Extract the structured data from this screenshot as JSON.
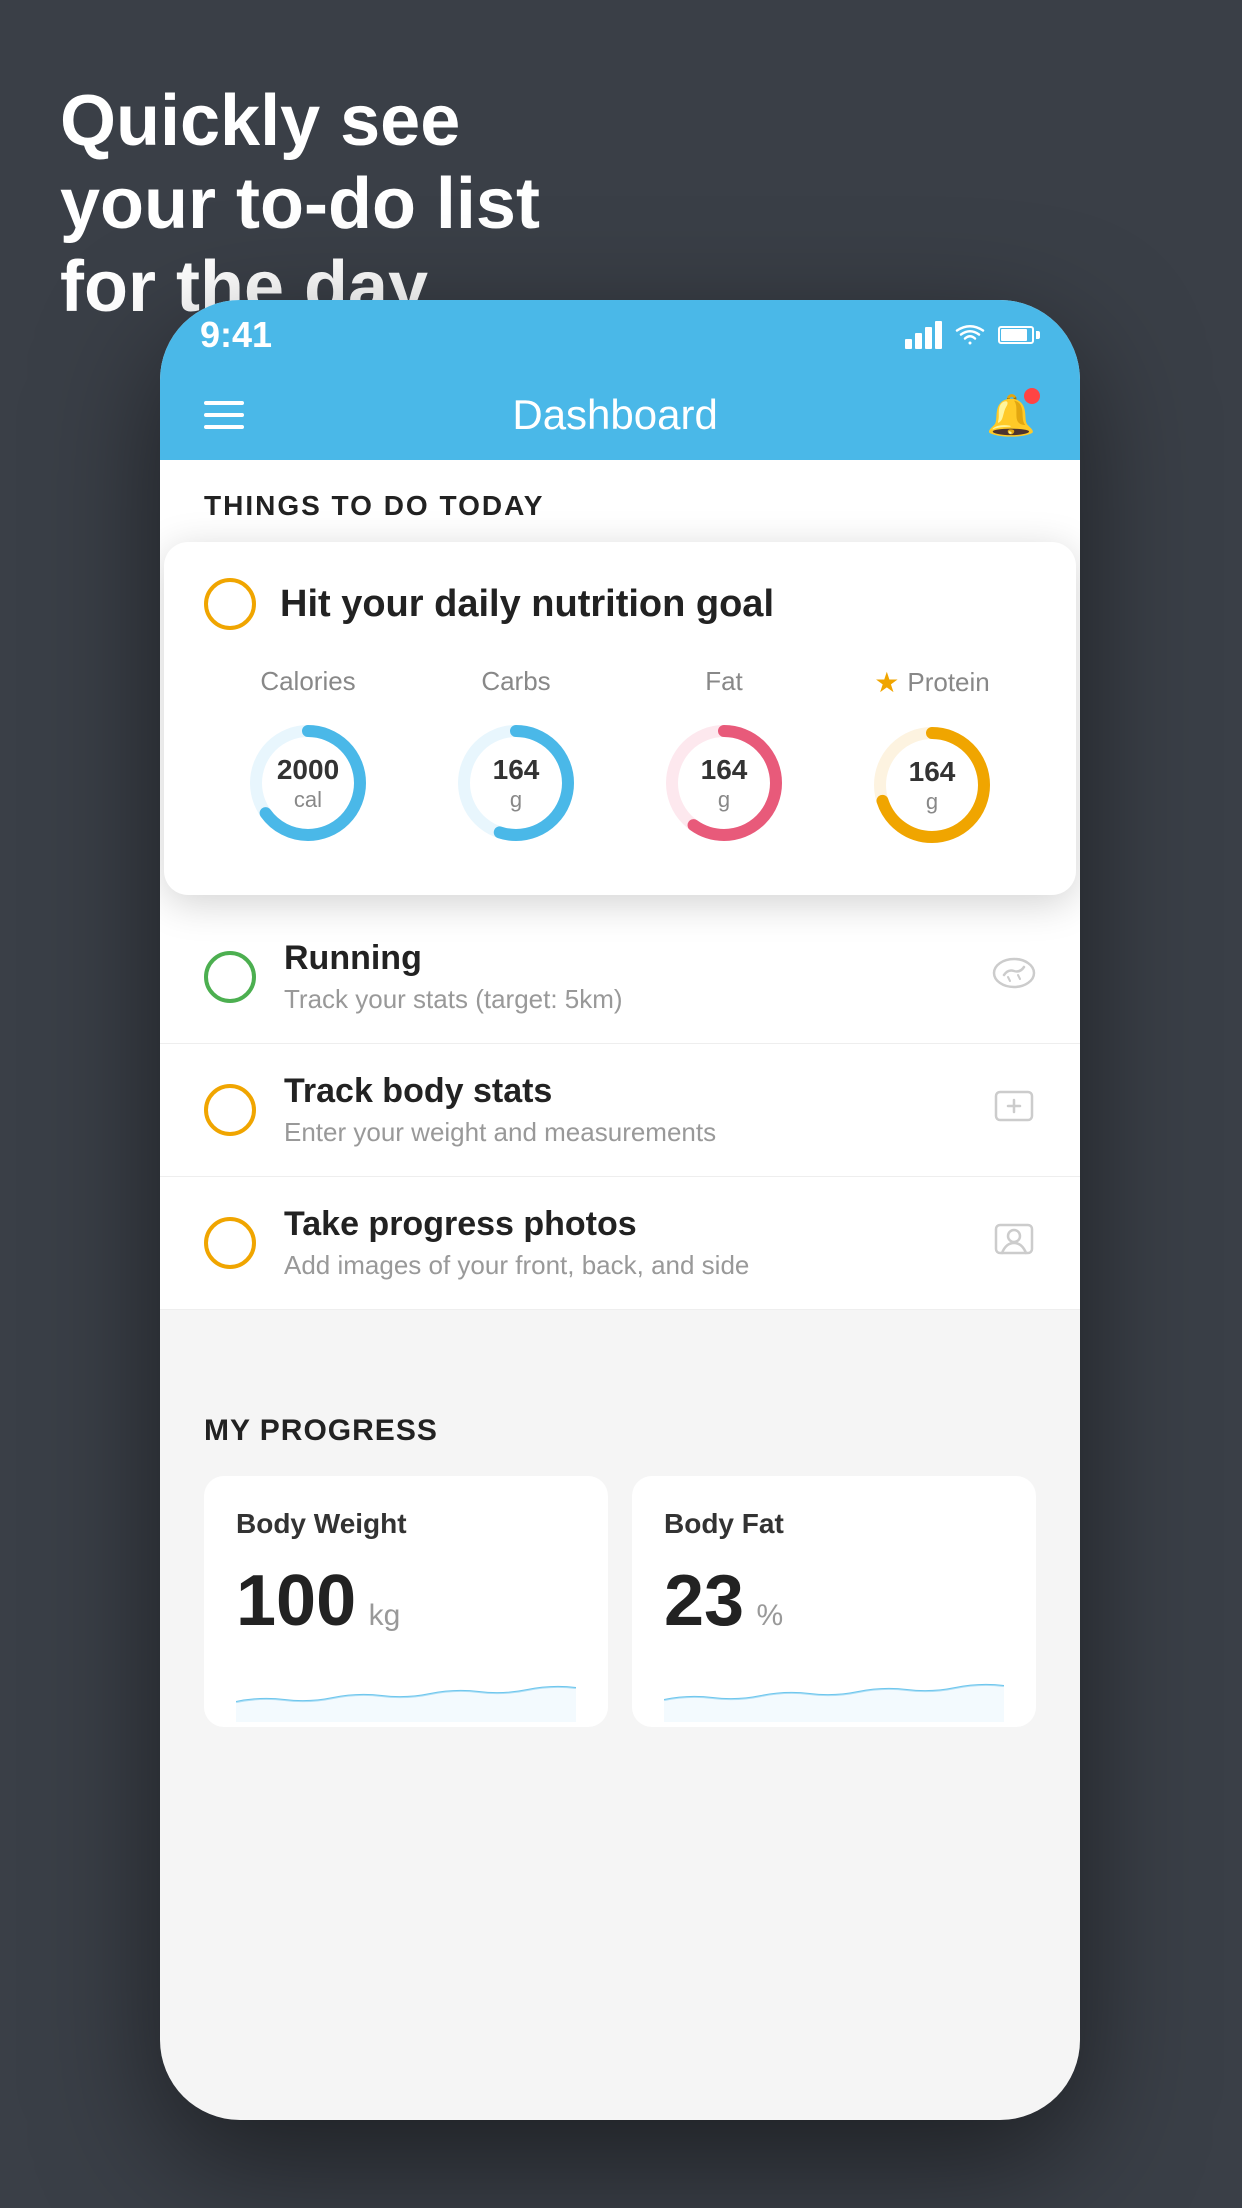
{
  "headline": {
    "line1": "Quickly see",
    "line2": "your to-do list",
    "line3": "for the day."
  },
  "phone": {
    "status": {
      "time": "9:41"
    },
    "nav": {
      "title": "Dashboard"
    },
    "things_label": "THINGS TO DO TODAY",
    "floating_card": {
      "title": "Hit your daily nutrition goal",
      "calories": {
        "label": "Calories",
        "value": "2000",
        "unit": "cal",
        "color": "#4ab8e8",
        "percent": 65
      },
      "carbs": {
        "label": "Carbs",
        "value": "164",
        "unit": "g",
        "color": "#4ab8e8",
        "percent": 55
      },
      "fat": {
        "label": "Fat",
        "value": "164",
        "unit": "g",
        "color": "#e85a7a",
        "percent": 60
      },
      "protein": {
        "label": "Protein",
        "value": "164",
        "unit": "g",
        "color": "#f0a500",
        "percent": 70
      }
    },
    "todo_items": [
      {
        "id": "running",
        "circle_color": "#4caf50",
        "title": "Running",
        "subtitle": "Track your stats (target: 5km)",
        "icon": "👟"
      },
      {
        "id": "body-stats",
        "circle_color": "#f0a500",
        "title": "Track body stats",
        "subtitle": "Enter your weight and measurements",
        "icon": "⚖️"
      },
      {
        "id": "progress-photos",
        "circle_color": "#f0a500",
        "title": "Take progress photos",
        "subtitle": "Add images of your front, back, and side",
        "icon": "👤"
      }
    ],
    "progress": {
      "title": "MY PROGRESS",
      "body_weight": {
        "label": "Body Weight",
        "value": "100",
        "unit": "kg"
      },
      "body_fat": {
        "label": "Body Fat",
        "value": "23",
        "unit": "%"
      }
    }
  }
}
